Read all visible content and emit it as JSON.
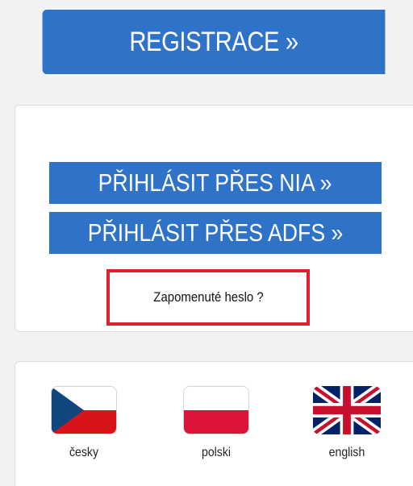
{
  "registration": {
    "label": "REGISTRACE »"
  },
  "login": {
    "nia_label": "PŘIHLÁSIT PŘES NIA »",
    "adfs_label": "PŘIHLÁSIT PŘES ADFS »",
    "forgot_password": "Zapomenuté heslo ?"
  },
  "languages": [
    {
      "label": "česky",
      "icon": "czech-flag-icon"
    },
    {
      "label": "polski",
      "icon": "polish-flag-icon"
    },
    {
      "label": "english",
      "icon": "uk-flag-icon"
    }
  ],
  "colors": {
    "accent": "#2f73c9",
    "highlight_border": "#e0202a"
  }
}
